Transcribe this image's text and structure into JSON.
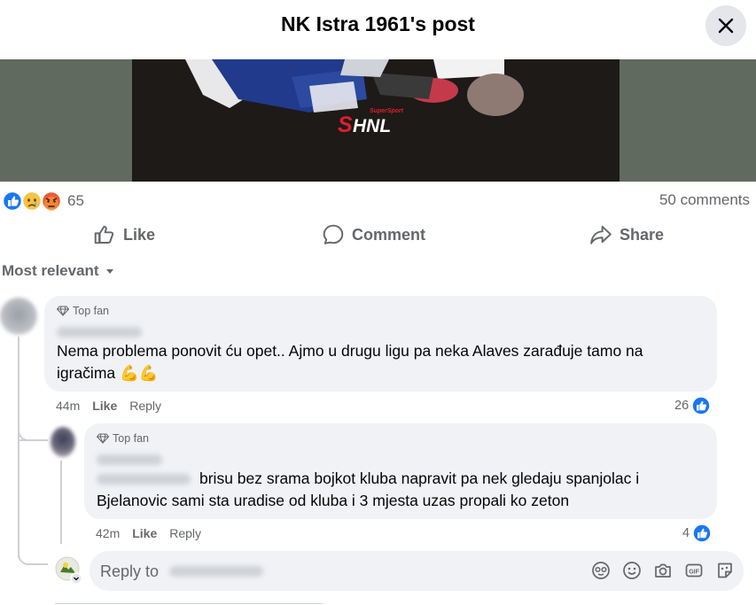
{
  "header": {
    "title": "NK Istra 1961's post"
  },
  "media": {
    "logo_text": "SHNL",
    "logo_small": "SuperSport"
  },
  "stats": {
    "reaction_count": "65",
    "comments": "50 comments"
  },
  "actions": {
    "like": "Like",
    "comment": "Comment",
    "share": "Share"
  },
  "sort": {
    "label": "Most relevant"
  },
  "comments": [
    {
      "badge": "Top fan",
      "text": "Nema problema ponovit ću opet.. Ajmo u drugu ligu pa neka Alaves zarađuje tamo na igračima 💪💪",
      "time": "44m",
      "like": "Like",
      "reply": "Reply",
      "likes": "26"
    },
    {
      "badge": "Top fan",
      "text": "brisu bez srama bojkot kluba napravit pa nek gledaju spanjolac i Bjelanovic sami sta uradise od kluba i 3 mjesta uzas propali ko zeton",
      "time": "42m",
      "like": "Like",
      "reply": "Reply",
      "likes": "4"
    }
  ],
  "reply_box": {
    "placeholder": "Reply to"
  },
  "colors": {
    "like_blue": "#1877f2",
    "bubble": "#f0f2f5",
    "secondary_text": "#65676b",
    "media_bg": "#616a5e"
  },
  "icons": [
    "close-icon",
    "like-icon",
    "comment-icon",
    "share-icon",
    "caret-down-icon",
    "diamond-icon",
    "avatar-icon",
    "emoji-icon",
    "camera-icon",
    "gif-icon",
    "sticker-icon"
  ]
}
